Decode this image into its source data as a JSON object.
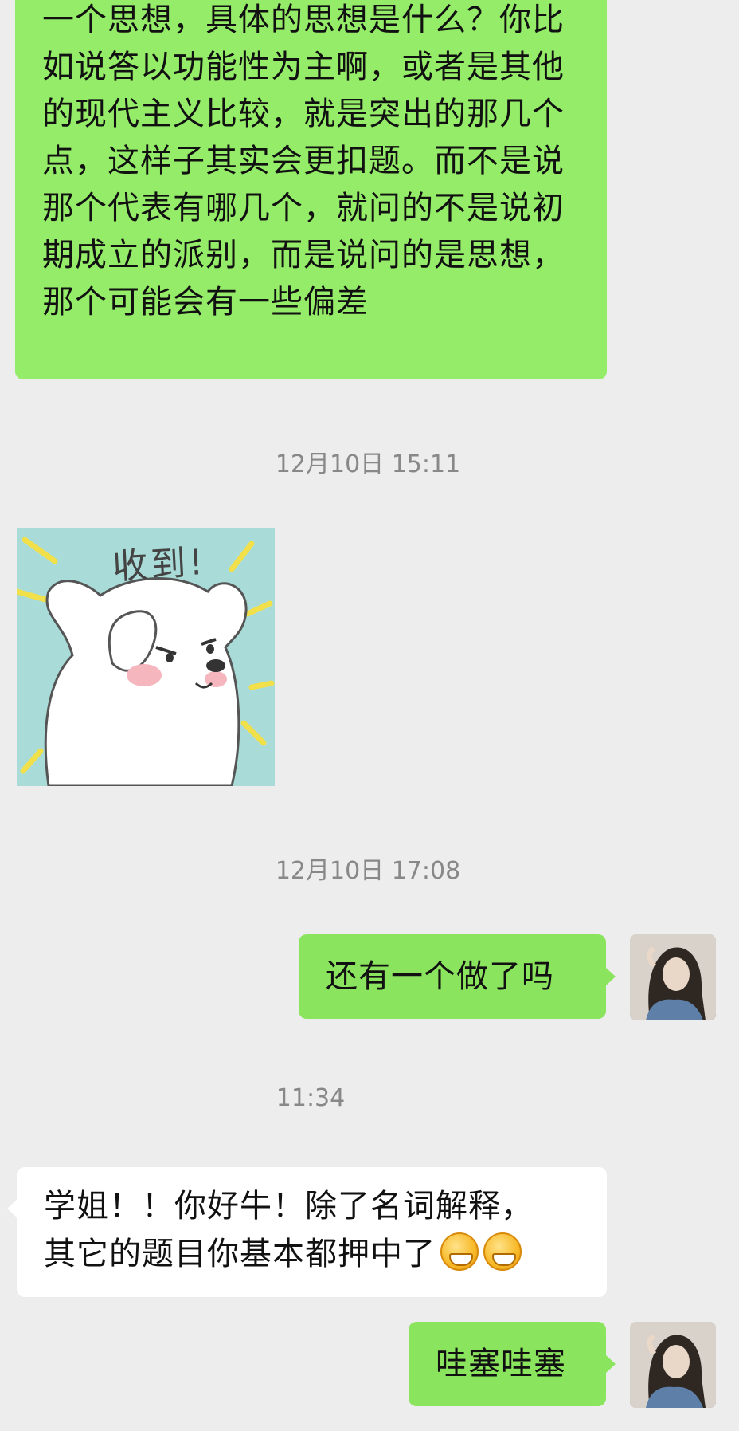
{
  "messages": {
    "m1": {
      "sender": "other",
      "text": "一个思想，具体的思想是什么？你比如说答以功能性为主啊，或者是其他的现代主义比较，就是突出的那几个点，这样子其实会更扣题。而不是说那个代表有哪几个，就问的不是说初期成立的派别，而是说问的是思想，那个可能会有一些偏差"
    },
    "ts1": "12月10日 15:11",
    "m2": {
      "sender": "other",
      "type": "sticker",
      "caption": "收到!"
    },
    "ts2": "12月10日 17:08",
    "m3": {
      "sender": "me",
      "text": "还有一个做了吗"
    },
    "ts3": "11:34",
    "m4": {
      "sender": "other",
      "line1": "学姐！！你好牛！除了名词解释，",
      "line2": "其它的题目你基本都押中了",
      "emojis": [
        "grimace-emoji",
        "grimace-emoji"
      ]
    },
    "m5": {
      "sender": "me",
      "text": "哇塞哇塞"
    }
  },
  "colors": {
    "background": "#ededed",
    "bubble_me": "#95ec69",
    "bubble_other": "#ffffff",
    "timestamp": "#888888"
  }
}
